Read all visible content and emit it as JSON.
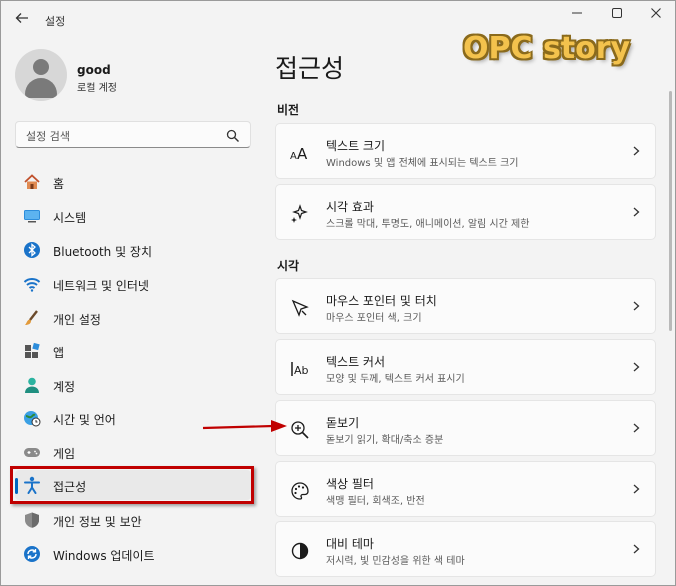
{
  "app": {
    "title": "설정",
    "back_icon": "back-arrow-icon",
    "window_controls": [
      "minimize-icon",
      "maximize-icon",
      "close-icon"
    ]
  },
  "watermark": "OPC story",
  "profile": {
    "name": "good",
    "account_type": "로컬 계정"
  },
  "search": {
    "placeholder": "설정 검색"
  },
  "sidebar": {
    "items": [
      {
        "label": "홈",
        "icon": "home-icon"
      },
      {
        "label": "시스템",
        "icon": "system-icon"
      },
      {
        "label": "Bluetooth 및 장치",
        "icon": "bluetooth-icon"
      },
      {
        "label": "네트워크 및 인터넷",
        "icon": "wifi-icon"
      },
      {
        "label": "개인 설정",
        "icon": "brush-icon"
      },
      {
        "label": "앱",
        "icon": "apps-icon"
      },
      {
        "label": "계정",
        "icon": "account-icon"
      },
      {
        "label": "시간 및 언어",
        "icon": "globe-clock-icon"
      },
      {
        "label": "게임",
        "icon": "gamepad-icon"
      },
      {
        "label": "접근성",
        "icon": "accessibility-icon",
        "selected": true
      },
      {
        "label": "개인 정보 및 보안",
        "icon": "shield-icon"
      },
      {
        "label": "Windows 업데이트",
        "icon": "update-icon"
      }
    ]
  },
  "main": {
    "title": "접근성",
    "sections": [
      {
        "label": "비전",
        "cards": [
          {
            "title": "텍스트 크기",
            "subtitle": "Windows 및 앱 전체에 표시되는 텍스트 크기",
            "icon": "text-size-icon"
          },
          {
            "title": "시각 효과",
            "subtitle": "스크롤 막대, 투명도, 애니메이션, 알림 시간 제한",
            "icon": "visual-effects-icon"
          }
        ]
      },
      {
        "label": "시각",
        "cards": [
          {
            "title": "마우스 포인터 및 터치",
            "subtitle": "마우스 포인터 색, 크기",
            "icon": "mouse-pointer-icon"
          },
          {
            "title": "텍스트 커서",
            "subtitle": "모양 및 두께, 텍스트 커서 표시기",
            "icon": "text-cursor-icon"
          },
          {
            "title": "돋보기",
            "subtitle": "돋보기 읽기, 확대/축소 증분",
            "icon": "magnifier-icon"
          },
          {
            "title": "색상 필터",
            "subtitle": "색맹 필터, 회색조, 반전",
            "icon": "color-filter-icon"
          },
          {
            "title": "대비 테마",
            "subtitle": "저시력, 빛 민감성을 위한 색 테마",
            "icon": "contrast-icon"
          }
        ]
      }
    ]
  },
  "colors": {
    "accent": "#0067c0",
    "highlight_box": "#c00000",
    "arrow": "#c00000",
    "watermark": "#f3c24d"
  }
}
